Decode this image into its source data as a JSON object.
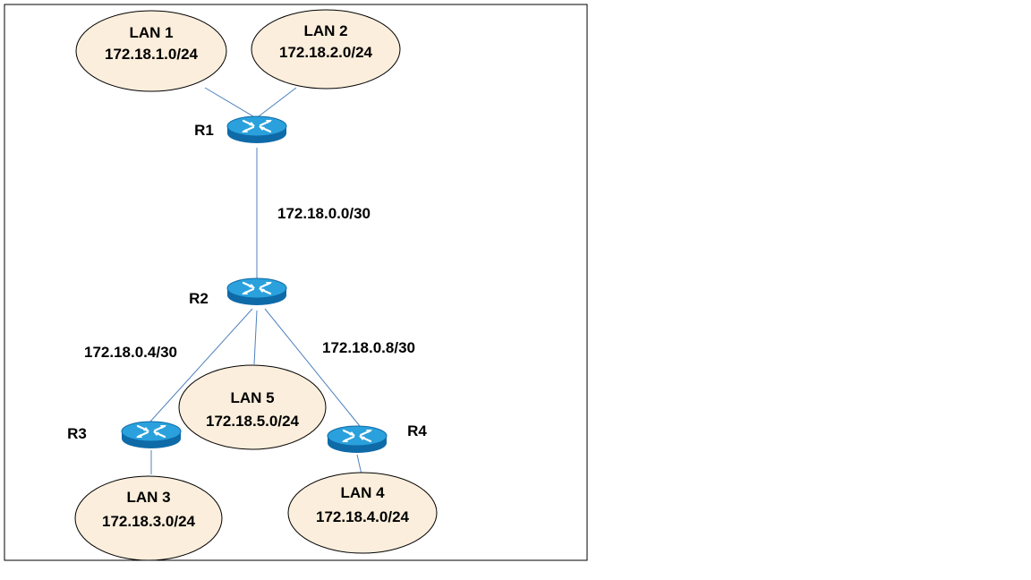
{
  "routers": [
    {
      "id": "r1",
      "label": "R1"
    },
    {
      "id": "r2",
      "label": "R2"
    },
    {
      "id": "r3",
      "label": "R3"
    },
    {
      "id": "r4",
      "label": "R4"
    }
  ],
  "lans": [
    {
      "id": "lan1",
      "name": "LAN 1",
      "subnet": "172.18.1.0/24"
    },
    {
      "id": "lan2",
      "name": "LAN 2",
      "subnet": "172.18.2.0/24"
    },
    {
      "id": "lan3",
      "name": "LAN 3",
      "subnet": "172.18.3.0/24"
    },
    {
      "id": "lan4",
      "name": "LAN 4",
      "subnet": "172.18.4.0/24"
    },
    {
      "id": "lan5",
      "name": "LAN 5",
      "subnet": "172.18.5.0/24"
    }
  ],
  "links": [
    {
      "id": "r1-r2",
      "label": "172.18.0.0/30"
    },
    {
      "id": "r2-r3",
      "label": "172.18.0.4/30"
    },
    {
      "id": "r2-r4",
      "label": "172.18.0.8/30"
    }
  ],
  "colors": {
    "lan_fill": "#fbeedc",
    "lan_stroke": "#000000",
    "link": "#4f81bd",
    "router_top": "#2aa1dc",
    "router_side": "#0f6aa8",
    "border": "#000000"
  }
}
